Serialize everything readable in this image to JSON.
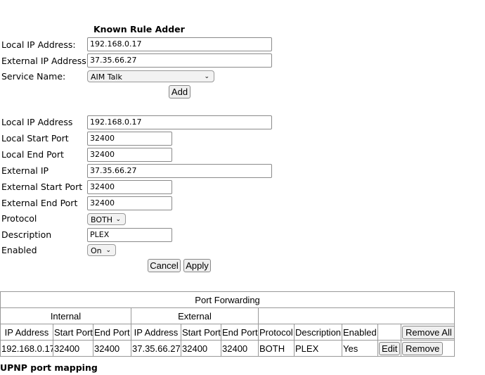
{
  "known_rule_adder": {
    "title": "Known Rule Adder",
    "local_ip_label": "Local IP Address:",
    "local_ip": "192.168.0.17",
    "external_ip_label": "External IP Address:",
    "external_ip": "37.35.66.27",
    "service_label": "Service Name:",
    "service": "AIM Talk",
    "add": "Add"
  },
  "rule_form": {
    "local_ip_label": "Local IP Address",
    "local_ip": "192.168.0.17",
    "local_start_label": "Local Start Port",
    "local_start": "32400",
    "local_end_label": "Local End Port",
    "local_end": "32400",
    "external_ip_label": "External IP",
    "external_ip": "37.35.66.27",
    "external_start_label": "External Start Port",
    "external_start": "32400",
    "external_end_label": "External End Port",
    "external_end": "32400",
    "protocol_label": "Protocol",
    "protocol": "BOTH",
    "description_label": "Description",
    "description": "PLEX",
    "enabled_label": "Enabled",
    "enabled": "On",
    "cancel": "Cancel",
    "apply": "Apply"
  },
  "table": {
    "title": "Port Forwarding",
    "group_internal": "Internal",
    "group_external": "External",
    "headers": [
      "IP Address",
      "Start Port",
      "End Port",
      "IP Address",
      "Start Port",
      "End Port",
      "Protocol",
      "Description",
      "Enabled"
    ],
    "remove_all": "Remove All",
    "rows": [
      {
        "cells": [
          "192.168.0.17",
          "32400",
          "32400",
          "37.35.66.27",
          "32400",
          "32400",
          "BOTH",
          "PLEX",
          "Yes"
        ],
        "edit": "Edit",
        "remove": "Remove"
      }
    ]
  },
  "upnp_heading": "UPNP port mapping"
}
